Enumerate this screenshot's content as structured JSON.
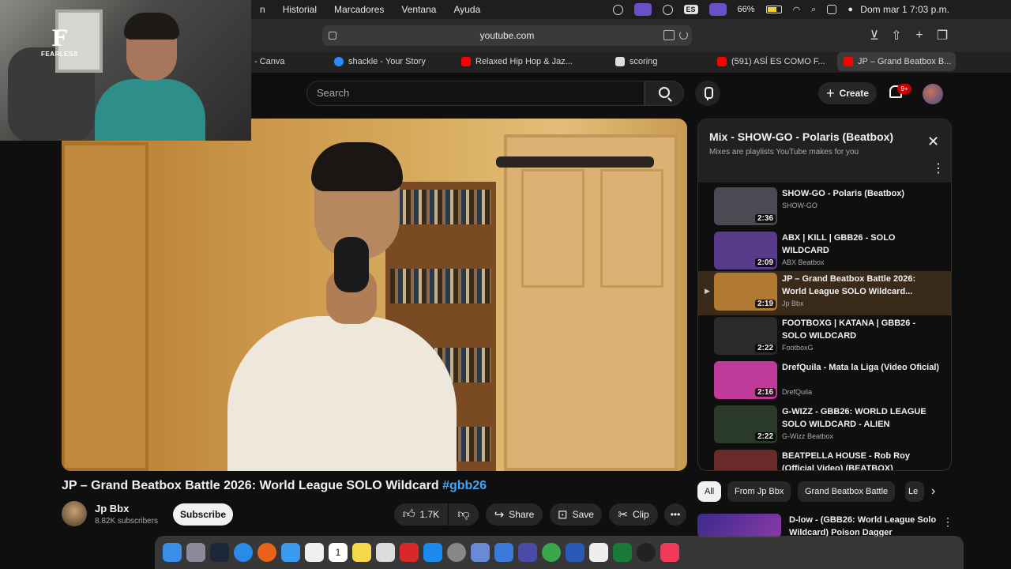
{
  "menubar": {
    "items": [
      "n",
      "Historial",
      "Marcadores",
      "Ventana",
      "Ayuda"
    ],
    "lang": "ES",
    "battery": "66%",
    "clock": "Dom mar 1  7:03 p.m."
  },
  "browser": {
    "url": "youtube.com",
    "tabs": [
      {
        "label": "- Canva",
        "icon": "canva-icon"
      },
      {
        "label": "shackle - Your Story",
        "icon": "shackle-icon"
      },
      {
        "label": "Relaxed Hip Hop & Jaz...",
        "icon": "youtube-icon"
      },
      {
        "label": "scoring",
        "icon": "scoring-icon"
      },
      {
        "label": "(591) ASÍ ES COMO F...",
        "icon": "youtube-icon"
      },
      {
        "label": "JP – Grand Beatbox B...",
        "icon": "youtube-icon"
      }
    ]
  },
  "webcam": {
    "logo_letter": "F",
    "logo_text": "FEARLESS"
  },
  "header": {
    "search_placeholder": "Search",
    "create_label": "Create",
    "notifications": "9+"
  },
  "video": {
    "title": "JP – Grand Beatbox Battle 2026: World League SOLO Wildcard",
    "hashtag": "#gbb26",
    "channel": "Jp Bbx",
    "subscribers": "8.82K subscribers",
    "subscribe_label": "Subscribe",
    "likes": "1.7K",
    "share_label": "Share",
    "save_label": "Save",
    "clip_label": "Clip"
  },
  "playlist": {
    "title": "Mix - SHOW-GO - Polaris (Beatbox)",
    "subtitle": "Mixes are playlists YouTube makes for you",
    "items": [
      {
        "title": "SHOW-GO - Polaris (Beatbox)",
        "channel": "SHOW-GO",
        "duration": "2:36",
        "color": "#4a4a52"
      },
      {
        "title": "ABX | KILL | GBB26 - SOLO WILDCARD",
        "channel": "ABX Beatbox",
        "duration": "2:09",
        "color": "#5a3a8a"
      },
      {
        "title": "JP – Grand Beatbox Battle 2026: World League SOLO Wildcard...",
        "channel": "Jp Bbx",
        "duration": "2:19",
        "color": "#b07a32"
      },
      {
        "title": "FOOTBOXG | KATANA | GBB26 - SOLO WILDCARD",
        "channel": "FootboxG",
        "duration": "2:22",
        "color": "#2a2a2a"
      },
      {
        "title": "DrefQuila - Mata la Liga (Video Oficial)",
        "channel": "DrefQuila",
        "duration": "2:16",
        "color": "#c03a9a"
      },
      {
        "title": "G-WIZZ - GBB26: WORLD LEAGUE SOLO WILDCARD - ALIEN",
        "channel": "G-Wizz Beatbox",
        "duration": "2:22",
        "color": "#2a3a2a"
      },
      {
        "title": "BEATPELLA HOUSE - Rob Roy (Official Video) (BEATBOX)",
        "channel": "",
        "duration": "",
        "color": "#6a2a2a"
      }
    ]
  },
  "chips": [
    "All",
    "From Jp Bbx",
    "Grand Beatbox Battle",
    "Le"
  ],
  "next_recommendation": {
    "title": "D-low - (GBB26: World League Solo Wildcard) Poison Dagger"
  },
  "dock": {
    "apps": [
      "finder",
      "launchpad",
      "steam",
      "safari",
      "firefox",
      "mail",
      "photos",
      "calendar",
      "notes",
      "screenshot",
      "recorder",
      "appstore",
      "settings",
      "preview",
      "finder2",
      "teams",
      "chrome",
      "word",
      "notes2",
      "excel",
      "chatgpt",
      "music"
    ],
    "calendar_day": "1"
  }
}
